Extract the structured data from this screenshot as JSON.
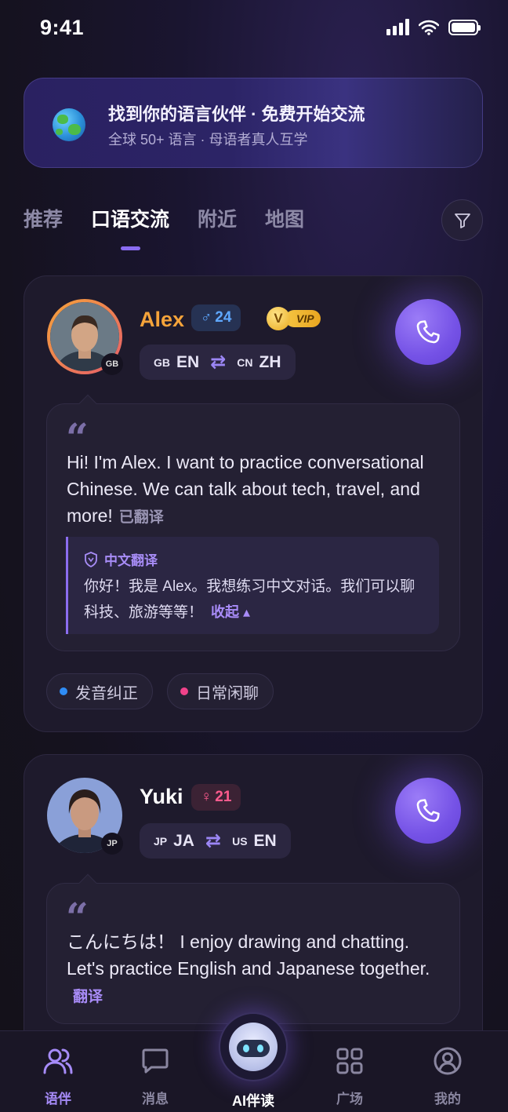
{
  "status_bar": {
    "time": "9:41"
  },
  "banner": {
    "title": "找到你的语言伙伴 · 免费开始交流",
    "subtitle": "全球 50+ 语言 · 母语者真人互学"
  },
  "tabs": [
    {
      "label": "推荐",
      "active": false
    },
    {
      "label": "口语交流",
      "active": true
    },
    {
      "label": "附近",
      "active": false
    },
    {
      "label": "地图",
      "active": false
    }
  ],
  "partners": [
    {
      "name": "Alex",
      "name_color": "#f5a33a",
      "gender_symbol": "♂",
      "age": "24",
      "country_code": "GB",
      "vip_label": "VIP",
      "vip_crown": "V",
      "native": {
        "code": "GB",
        "lang": "EN"
      },
      "learning": {
        "code": "CN",
        "lang": "ZH"
      },
      "message": "Hi! I'm Alex. I want to practice conversational Chinese. We can talk about tech, travel, and more!",
      "translated_tag": "已翻译",
      "translation_title": "中文翻译",
      "translation": "你好！我是 Alex。我想练习中文对话。我们可以聊科技、旅游等等！",
      "collapse_label": "收起 ▴",
      "tags": [
        {
          "label": "发音纠正",
          "color": "#2f8cf5"
        },
        {
          "label": "日常闲聊",
          "color": "#f0428a"
        }
      ]
    },
    {
      "name": "Yuki",
      "name_color": "#ffffff",
      "gender_symbol": "♀",
      "age": "21",
      "country_code": "JP",
      "native": {
        "code": "JP",
        "lang": "JA"
      },
      "learning": {
        "code": "US",
        "lang": "EN"
      },
      "message": "こんにちは！ I enjoy drawing and chatting. Let's practice English and Japanese together.",
      "translate_label": "翻译"
    }
  ],
  "nav": [
    {
      "label": "语伴",
      "icon": "partners-icon",
      "active": true
    },
    {
      "label": "消息",
      "icon": "message-icon",
      "active": false
    },
    {
      "label": "AI伴读",
      "icon": "ai-robot-icon",
      "active": false
    },
    {
      "label": "广场",
      "icon": "grid-icon",
      "active": false
    },
    {
      "label": "我的",
      "icon": "profile-icon",
      "active": false
    }
  ],
  "colors": {
    "accent": "#8a6cf2",
    "background": "#15121f"
  }
}
